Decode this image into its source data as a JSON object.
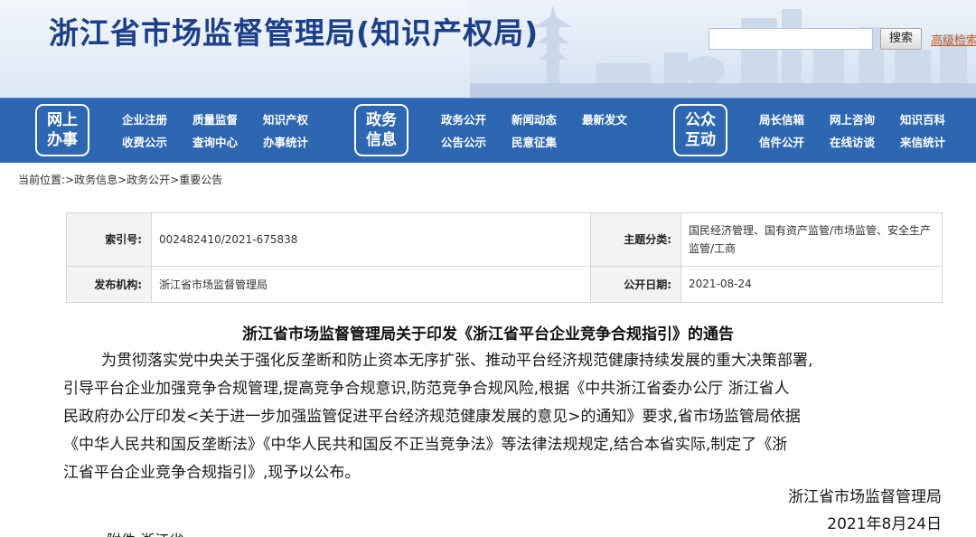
{
  "header": {
    "site_title": "浙江省市场监督管理局(知识产权局)",
    "search_button": "搜索",
    "search_placeholder": "",
    "advanced_search": "高级检索"
  },
  "nav": {
    "groups": [
      {
        "badge": [
          "网上",
          "办事"
        ],
        "links": [
          [
            "企业注册",
            "质量监督",
            "知识产权"
          ],
          [
            "收费公示",
            "查询中心",
            "办事统计"
          ]
        ]
      },
      {
        "badge": [
          "政务",
          "信息"
        ],
        "links": [
          [
            "政务公开",
            "新闻动态",
            "最新发文"
          ],
          [
            "公告公示",
            "民意征集",
            ""
          ]
        ]
      },
      {
        "badge": [
          "公众",
          "互动"
        ],
        "links": [
          [
            "局长信箱",
            "网上咨询",
            "知识百科"
          ],
          [
            "信件公开",
            "在线访谈",
            "来信统计"
          ]
        ]
      }
    ],
    "colors": {
      "bar": "#2e67b1",
      "text": "#ffffff"
    }
  },
  "breadcrumb": "当前位置:>政务信息>政务公开>重要公告",
  "info": {
    "index_label": "索引号:",
    "index_value": "002482410/2021-675838",
    "subject_label": "主题分类:",
    "subject_value": "国民经济管理、国有资产监管/市场监管、安全生产监管/工商",
    "publisher_label": "发布机构:",
    "publisher_value": "浙江省市场监督管理局",
    "date_label": "公开日期:",
    "date_value": "2021-08-24"
  },
  "article": {
    "title": "浙江省市场监督管理局关于印发《浙江省平台企业竞争合规指引》的通告",
    "lines": [
      "为贯彻落实党中央关于强化反垄断和防止资本无序扩张、推动平台经济规范健康持续发展的重大决策部署,",
      "引导平台企业加强竞争合规管理,提高竞争合规意识,防范竞争合规风险,根据《中共浙江省委办公厅 浙江省人",
      "民政府办公厅印发<关于进一步加强监管促进平台经济规范健康发展的意见>的通知》要求,省市场监管局依据",
      "《中华人民共和国反垄断法》《中华人民共和国反不正当竞争法》等法律法规规定,结合本省实际,制定了《浙",
      "江省平台企业竞争合规指引》,现予以公布。"
    ],
    "signature_org": "浙江省市场监督管理局",
    "signature_date": "2021年8月24日",
    "cutoff_text": "附件:浙江省"
  }
}
